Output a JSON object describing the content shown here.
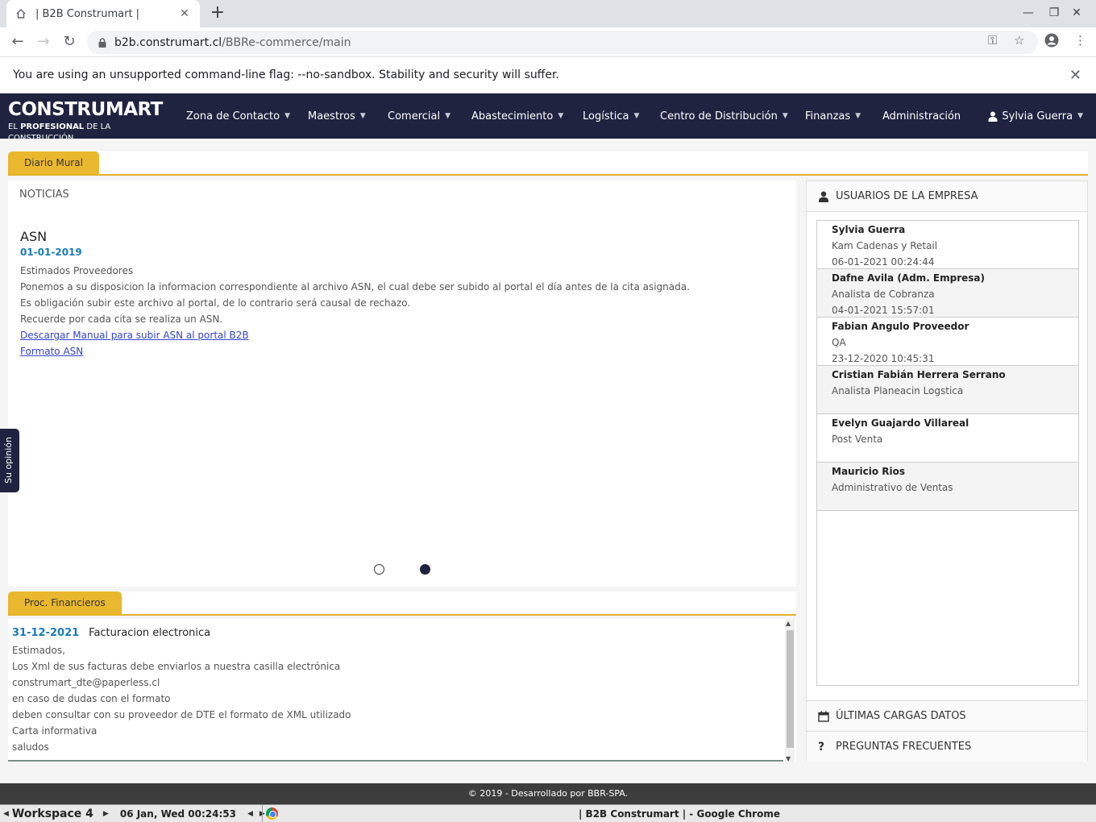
{
  "browser": {
    "tab_title": "| B2B Construmart |",
    "url_host": "b2b.construmart.cl",
    "url_path": "/BBRe-commerce/main",
    "infobar_text": "You are using an unsupported command-line flag: --no-sandbox. Stability and security will suffer."
  },
  "nav": {
    "logo_main": "CONSTRUMART",
    "logo_sub_prefix": "EL",
    "logo_sub_bold": "PROFESIONAL",
    "logo_sub_suffix": "DE LA CONSTRUCCIÓN",
    "menu": [
      {
        "label": "Zona de Contacto"
      },
      {
        "label": "Maestros"
      },
      {
        "label": "Comercial"
      },
      {
        "label": "Abastecimiento"
      },
      {
        "label": "Logística"
      },
      {
        "label": "Centro de Distribución"
      },
      {
        "label": "Finanzas"
      },
      {
        "label": "Administración"
      }
    ],
    "user": "Sylvia Guerra"
  },
  "main": {
    "tab_label": "Diario Mural",
    "news_header": "NOTICIAS",
    "news": {
      "title": "ASN",
      "date": "01-01-2019",
      "lines": [
        "Estimados Proveedores",
        "Ponemos a su disposicion la informacion correspondiente al archivo ASN, el cual debe ser subido al portal el día antes de la cita asignada.",
        "Es obligación subir este archivo al portal, de lo contrario será causal de rechazo.",
        "Recuerde por cada cita se realiza un ASN."
      ],
      "link1": "Descargar Manual para subir ASN al portal B2B",
      "link2": "Formato ASN"
    },
    "carousel_active": 2,
    "feedback": "Su opinión"
  },
  "financial": {
    "tab_label": "Proc. Financieros",
    "date": "31-12-2021",
    "title": "Facturacion electronica",
    "lines": [
      "Estimados,",
      "Los Xml de sus facturas debe enviarlos a nuestra casilla electrónica",
      "construmart_dte@paperless.cl",
      "en caso de dudas con el formato",
      "deben consultar con su proveedor de DTE el formato de XML utilizado",
      "Carta informativa",
      "saludos"
    ]
  },
  "sidebar": {
    "users_title": "USUARIOS DE LA EMPRESA",
    "users": [
      {
        "name": "Sylvia Guerra",
        "role": "Kam Cadenas y Retail",
        "time": "06-01-2021 00:24:44"
      },
      {
        "name": "Dafne Avila (Adm. Empresa)",
        "role": "Analista de Cobranza",
        "time": "04-01-2021 15:57:01"
      },
      {
        "name": "Fabian Angulo Proveedor",
        "role": "QA",
        "time": "23-12-2020 10:45:31"
      },
      {
        "name": "Cristian Fabián Herrera Serrano",
        "role": "Analista Planeacin Logstica",
        "time": ""
      },
      {
        "name": "Evelyn Guajardo Villareal",
        "role": "Post Venta",
        "time": ""
      },
      {
        "name": "Mauricio Rios",
        "role": "Administrativo de Ventas",
        "time": ""
      }
    ],
    "loads_title": "ÚLTIMAS CARGAS DATOS",
    "faq_title": "PREGUNTAS FRECUENTES"
  },
  "footer": "© 2019 - Desarrollado por BBR-SPA.",
  "taskbar": {
    "workspace": "Workspace 4",
    "clock": "06 Jan, Wed 00:24:53",
    "window_title": "| B2B Construmart | - Google Chrome"
  },
  "colors": {
    "nav_bg": "#1f2340",
    "tab_yellow": "#eab82e",
    "date_blue": "#1a7ab8",
    "link_blue": "#3344cc"
  }
}
